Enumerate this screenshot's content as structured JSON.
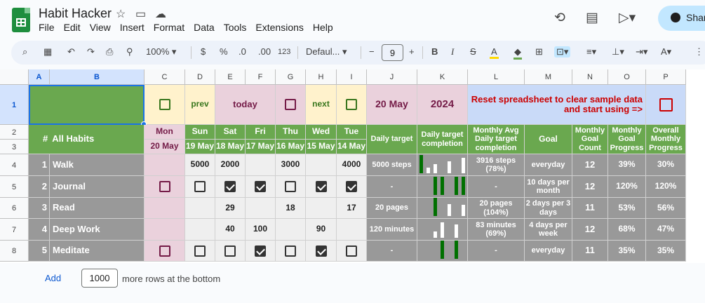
{
  "app": {
    "title": "Habit Hacker",
    "share_label": "Shar"
  },
  "menu": [
    "File",
    "Edit",
    "View",
    "Insert",
    "Format",
    "Data",
    "Tools",
    "Extensions",
    "Help"
  ],
  "toolbar": {
    "zoom": "100%",
    "currency": "$",
    "percent": "%",
    "dec_dec": ".0",
    "inc_dec": ".00",
    "num_format": "123",
    "font": "Defaul...",
    "font_size": "9"
  },
  "columns": [
    "A",
    "B",
    "C",
    "D",
    "E",
    "F",
    "G",
    "H",
    "I",
    "J",
    "K",
    "L",
    "M",
    "N",
    "O",
    "P"
  ],
  "rows": [
    "1",
    "2",
    "3",
    "4",
    "5",
    "6",
    "7",
    "8"
  ],
  "row1": {
    "prev": "prev",
    "today": "today",
    "next": "next",
    "date": "20 May",
    "year": "2024",
    "reset": "Reset spreadsheet to clear sample data and start using =>"
  },
  "header": {
    "num": "#",
    "all_habits": "All Habits",
    "days": [
      "Mon",
      "Sun",
      "Sat",
      "Fri",
      "Thu",
      "Wed",
      "Tue"
    ],
    "dates": [
      "20 May",
      "19 May",
      "18 May",
      "17 May",
      "16 May",
      "15 May",
      "14 May"
    ],
    "daily_target": "Daily target",
    "completion": "Daily target completion",
    "monthly_avg": "Monthly Avg Daily target completion",
    "goal": "Goal",
    "goal_count": "Monthly Goal Count",
    "goal_progress": "Monthly Goal Progress",
    "overall": "Overall Monthly Progress"
  },
  "habits": [
    {
      "num": "1",
      "name": "Walk",
      "target": "5000 steps",
      "avg": "3916 steps (78%)",
      "goal": "everyday",
      "count": "12",
      "progress": "39%",
      "overall": "30%",
      "values": [
        "",
        "5000",
        "2000",
        "",
        "3000",
        "",
        "4000"
      ],
      "spark": [
        1,
        0.3,
        0.5,
        0,
        0.65,
        0,
        0.85
      ]
    },
    {
      "num": "2",
      "name": "Journal",
      "target": "-",
      "avg": "-",
      "goal": "10 days per month",
      "count": "12",
      "progress": "120%",
      "overall": "120%",
      "checks": [
        false,
        false,
        true,
        true,
        false,
        true,
        true
      ],
      "spark": [
        0,
        0,
        1,
        1,
        0,
        1,
        1
      ]
    },
    {
      "num": "3",
      "name": "Read",
      "target": "20 pages",
      "avg": "20 pages (104%)",
      "goal": "2 days per 3 days",
      "count": "11",
      "progress": "53%",
      "overall": "56%",
      "values": [
        "",
        "",
        "29",
        "",
        "18",
        "",
        "17"
      ],
      "spark": [
        0,
        0,
        1,
        0,
        0.65,
        0,
        0.6
      ]
    },
    {
      "num": "4",
      "name": "Deep Work",
      "target": "120 minutes",
      "avg": "83 minutes (69%)",
      "goal": "4 days per week",
      "count": "12",
      "progress": "68%",
      "overall": "47%",
      "values": [
        "",
        "",
        "40",
        "100",
        "",
        "90",
        ""
      ],
      "spark": [
        0,
        0,
        0.35,
        0.85,
        0,
        0.75,
        0
      ]
    },
    {
      "num": "5",
      "name": "Meditate",
      "target": "-",
      "avg": "-",
      "goal": "everyday",
      "count": "11",
      "progress": "35%",
      "overall": "35%",
      "checks": [
        false,
        false,
        false,
        true,
        false,
        true,
        false
      ],
      "spark": [
        0,
        0,
        0,
        1,
        0,
        1,
        0
      ]
    }
  ],
  "footer": {
    "add": "Add",
    "rows": "1000",
    "more": "more rows at the bottom"
  },
  "colors": {
    "green": "#6aa84f",
    "dark_green": "#007000",
    "gray": "#999999",
    "pink": "#ead1dc",
    "yellow": "#fff2cc",
    "blue": "#c9daf8",
    "red": "#cc0000",
    "plum": "#741b47"
  }
}
